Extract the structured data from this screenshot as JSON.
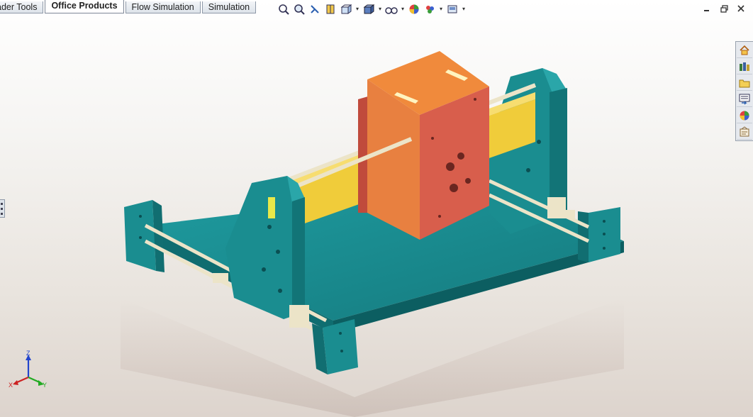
{
  "tabs": [
    {
      "label": "ader Tools",
      "active": false
    },
    {
      "label": "Office Products",
      "active": true
    },
    {
      "label": "Flow Simulation",
      "active": false
    },
    {
      "label": "Simulation",
      "active": false
    }
  ],
  "toolbar": {
    "icons": [
      "zoom-to-fit-icon",
      "zoom-to-area-icon",
      "previous-view-icon",
      "section-view-icon",
      "view-orientation-icon",
      "display-style-icon",
      "hide-show-items-icon",
      "edit-appearance-icon",
      "apply-scene-icon",
      "view-settings-icon"
    ]
  },
  "triad": {
    "x": "X",
    "y": "Y",
    "z": "Z"
  },
  "colors": {
    "base": "#178a8c",
    "carriage_orange": "#f08a3c",
    "carriage_red": "#d85e4c",
    "beam_yellow": "#f0cc3a",
    "rail": "#ece4c8"
  }
}
